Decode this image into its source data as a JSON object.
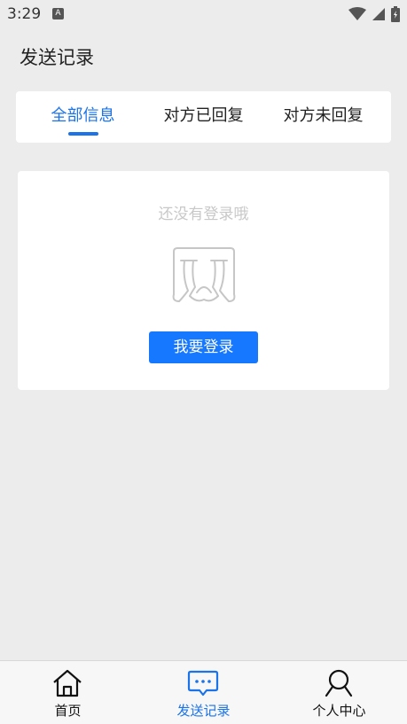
{
  "status_bar": {
    "time": "3:29",
    "notification_badge": "A"
  },
  "page": {
    "title": "发送记录"
  },
  "tabs": [
    {
      "label": "全部信息",
      "active": true
    },
    {
      "label": "对方已回复",
      "active": false
    },
    {
      "label": "对方未回复",
      "active": false
    }
  ],
  "empty_state": {
    "message": "还没有登录哦",
    "illustration_icon": "crying-face-icon",
    "button_label": "我要登录"
  },
  "bottom_nav": [
    {
      "label": "首页",
      "icon": "home-icon",
      "active": false
    },
    {
      "label": "发送记录",
      "icon": "message-icon",
      "active": true
    },
    {
      "label": "个人中心",
      "icon": "person-icon",
      "active": false
    }
  ],
  "colors": {
    "accent": "#1a73e8",
    "button": "#1677ff",
    "background": "#ececec"
  }
}
